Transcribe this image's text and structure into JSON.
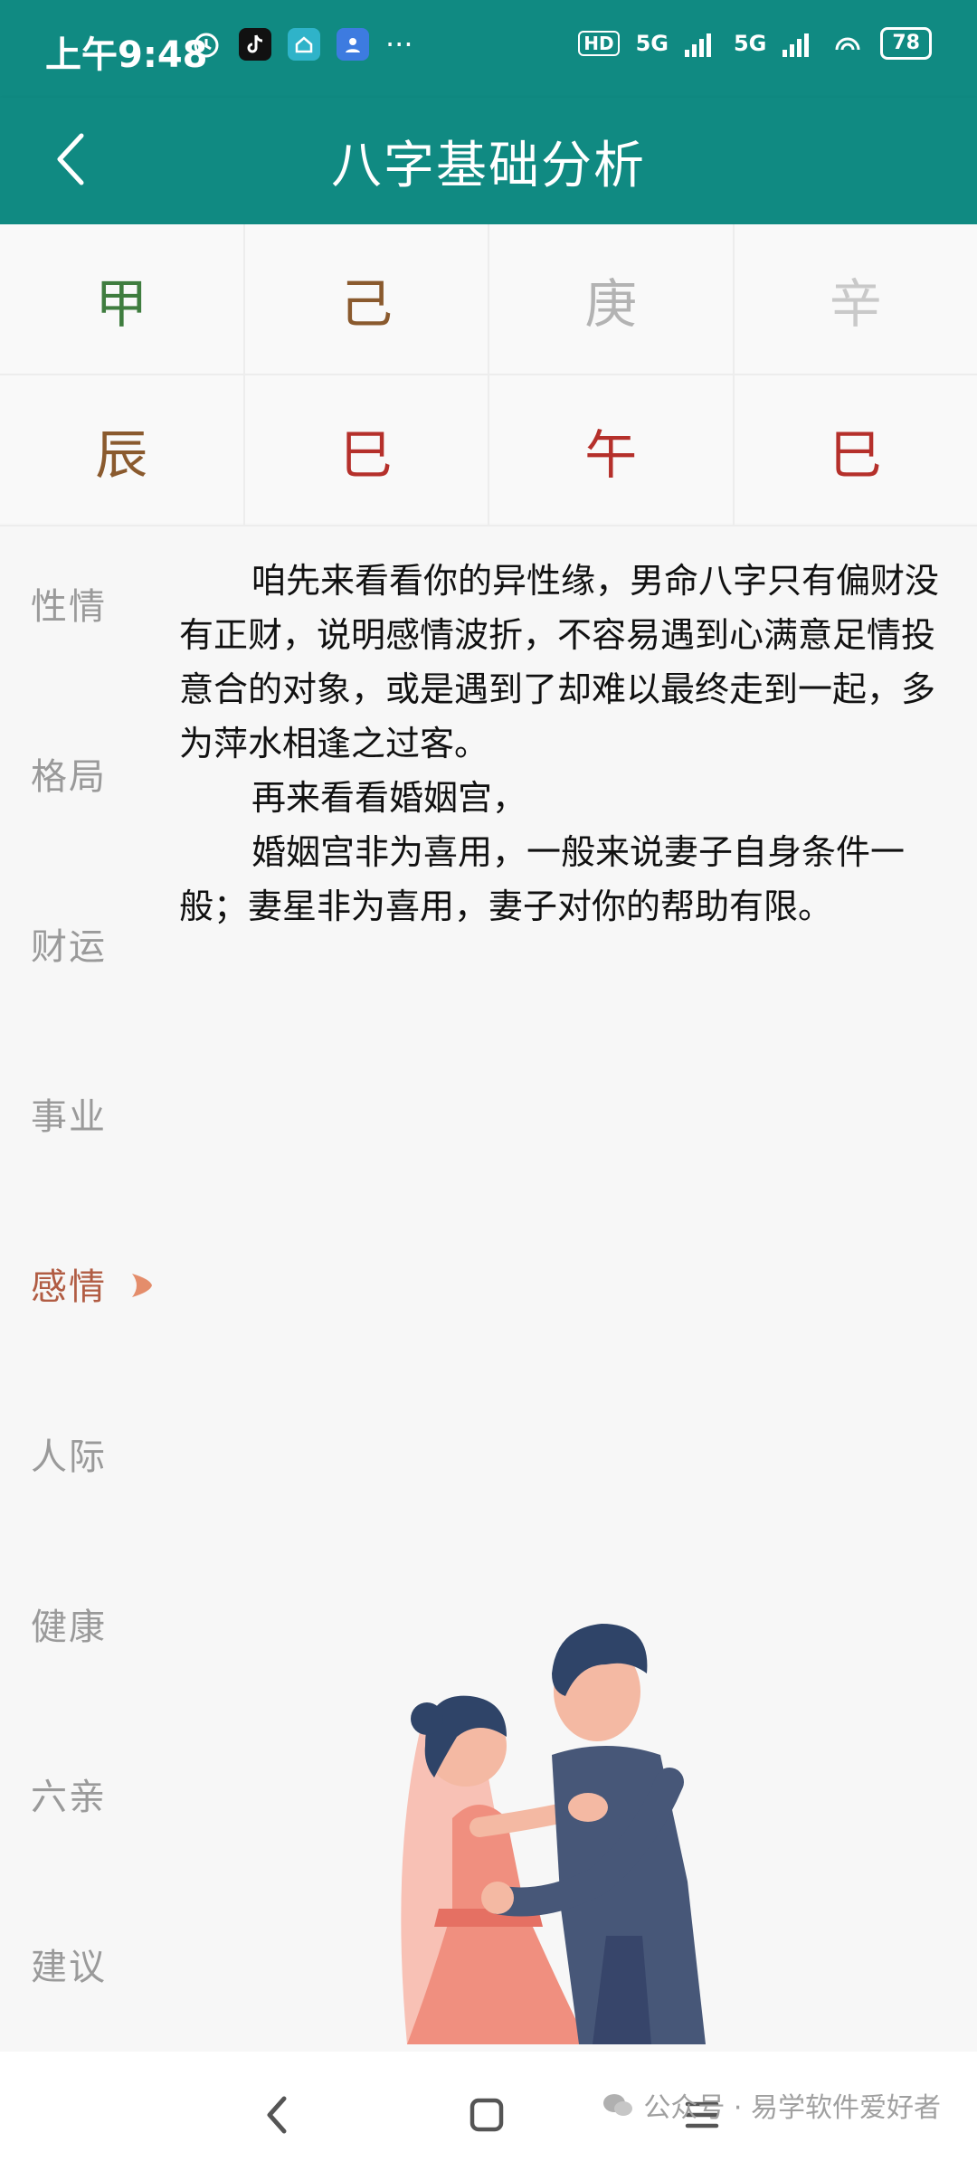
{
  "status": {
    "time": "上午9:48",
    "network_1": "5G",
    "network_2": "5G",
    "hd": "HD",
    "battery": "78",
    "more": "···"
  },
  "appbar": {
    "title": "八字基础分析"
  },
  "pillars": {
    "stems": [
      {
        "char": "甲",
        "color": "#3f7d3f"
      },
      {
        "char": "己",
        "color": "#8a5a2e"
      },
      {
        "char": "庚",
        "color": "#b3b3b3"
      },
      {
        "char": "辛",
        "color": "#c9c9c9"
      }
    ],
    "branches": [
      {
        "char": "辰",
        "color": "#8a5a2e"
      },
      {
        "char": "巳",
        "color": "#b5302b"
      },
      {
        "char": "午",
        "color": "#b5302b"
      },
      {
        "char": "巳",
        "color": "#b5302b"
      }
    ]
  },
  "sidebar": {
    "items": [
      {
        "label": "性情"
      },
      {
        "label": "格局"
      },
      {
        "label": "财运"
      },
      {
        "label": "事业"
      },
      {
        "label": "感情",
        "active": true
      },
      {
        "label": "人际"
      },
      {
        "label": "健康"
      },
      {
        "label": "六亲"
      },
      {
        "label": "建议"
      }
    ]
  },
  "content": {
    "paragraphs": [
      "咱先来看看你的异性缘，男命八字只有偏财没有正财，说明感情波折，不容易遇到心满意足情投意合的对象，或是遇到了却难以最终走到一起，多为萍水相逢之过客。",
      "再来看看婚姻宫，",
      "婚姻宫非为喜用，一般来说妻子自身条件一般；妻星非为喜用，妻子对你的帮助有限。"
    ]
  },
  "watermark": {
    "text": "公众号 · 易学软件爱好者"
  },
  "colors": {
    "accent": "#108a82",
    "active": "#b15c43"
  }
}
